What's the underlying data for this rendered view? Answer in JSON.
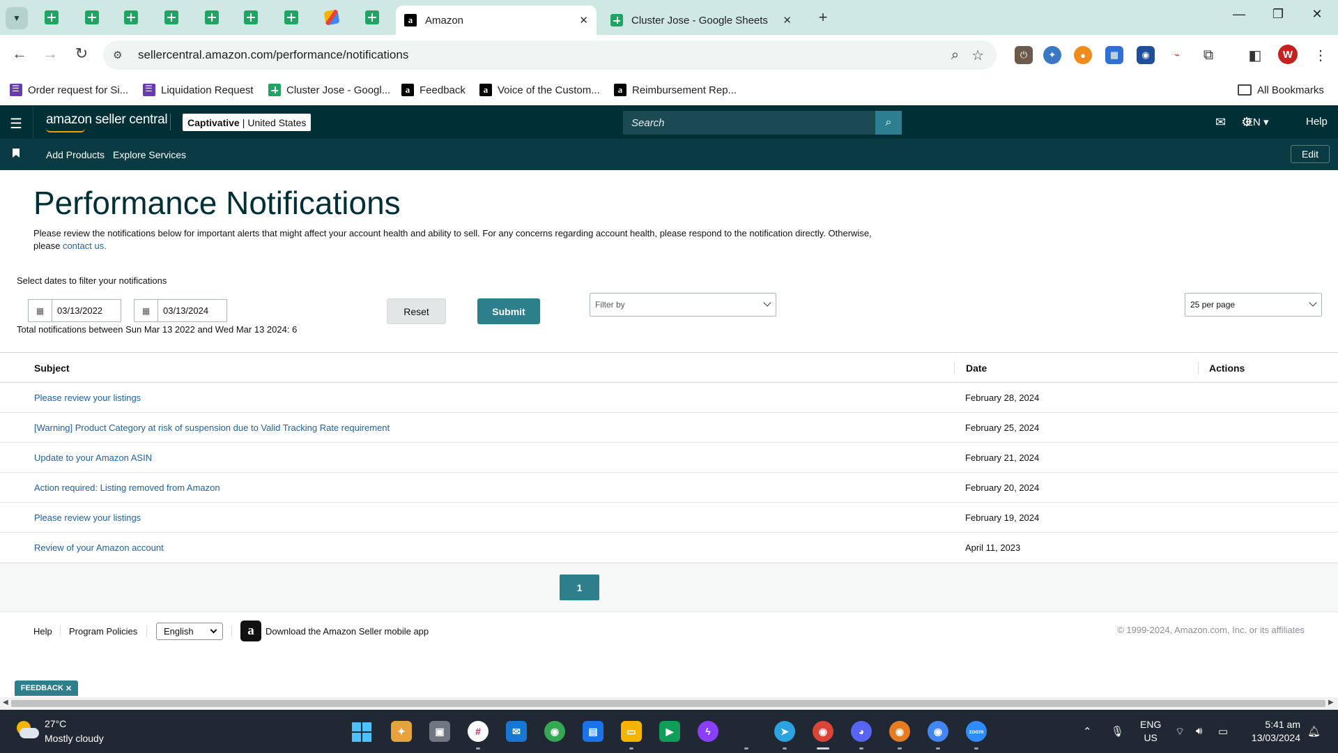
{
  "browser": {
    "active_tab": {
      "title": "Amazon"
    },
    "other_tab": {
      "title": "Cluster Jose - Google Sheets"
    },
    "url": "sellercentral.amazon.com/performance/notifications",
    "bookmarks": [
      {
        "label": "Order request for Si..."
      },
      {
        "label": "Liquidation Request"
      },
      {
        "label": "Cluster Jose - Googl..."
      },
      {
        "label": "Feedback"
      },
      {
        "label": "Voice of the Custom..."
      },
      {
        "label": "Reimbursement Rep..."
      }
    ],
    "all_bookmarks": "All Bookmarks",
    "profile_initial": "W"
  },
  "header": {
    "logo_text": "amazon seller central",
    "store_name": "Captivative",
    "marketplace": "United States",
    "search_placeholder": "Search",
    "language": "EN",
    "help": "Help",
    "accent": "#002f36"
  },
  "subnav": {
    "links": [
      "Add Products",
      "Explore Services"
    ],
    "edit": "Edit"
  },
  "page": {
    "title": "Performance Notifications",
    "intro": "Please review the notifications below for important alerts that might affect your account health and ability to sell. For any concerns regarding account health, please respond to the notification directly. Otherwise, please",
    "contact_link": "contact us.",
    "filter_label": "Select dates to filter your notifications",
    "date_from": "03/13/2022",
    "date_to": "03/13/2024",
    "total_text": "Total notifications between Sun Mar 13 2022 and Wed Mar 13 2024: 6",
    "reset": "Reset",
    "submit": "Submit",
    "filter_by_placeholder": "Filter by",
    "per_page": "25 per page"
  },
  "table": {
    "headers": {
      "subject": "Subject",
      "date": "Date",
      "actions": "Actions"
    },
    "rows": [
      {
        "subject": "Please review your listings",
        "date": "February 28, 2024"
      },
      {
        "subject": "[Warning] Product Category at risk of suspension due to Valid Tracking Rate requirement",
        "date": "February 25, 2024"
      },
      {
        "subject": "Update to your Amazon ASIN",
        "date": "February 21, 2024"
      },
      {
        "subject": "Action required: Listing removed from Amazon",
        "date": "February 20, 2024"
      },
      {
        "subject": "Please review your listings",
        "date": "February 19, 2024"
      },
      {
        "subject": "Review of your Amazon account",
        "date": "April 11, 2023"
      }
    ]
  },
  "pagination": {
    "current": "1"
  },
  "footer": {
    "help": "Help",
    "policies": "Program Policies",
    "language": "English",
    "app_text": "Download the Amazon Seller mobile app",
    "copyright": "© 1999-2024, Amazon.com, Inc. or its affiliates"
  },
  "feedback_tab": "FEEDBACK",
  "taskbar": {
    "temperature": "27°C",
    "weather": "Mostly cloudy",
    "lang_line1": "ENG",
    "lang_line2": "US",
    "time": "5:41 am",
    "date": "13/03/2024"
  }
}
